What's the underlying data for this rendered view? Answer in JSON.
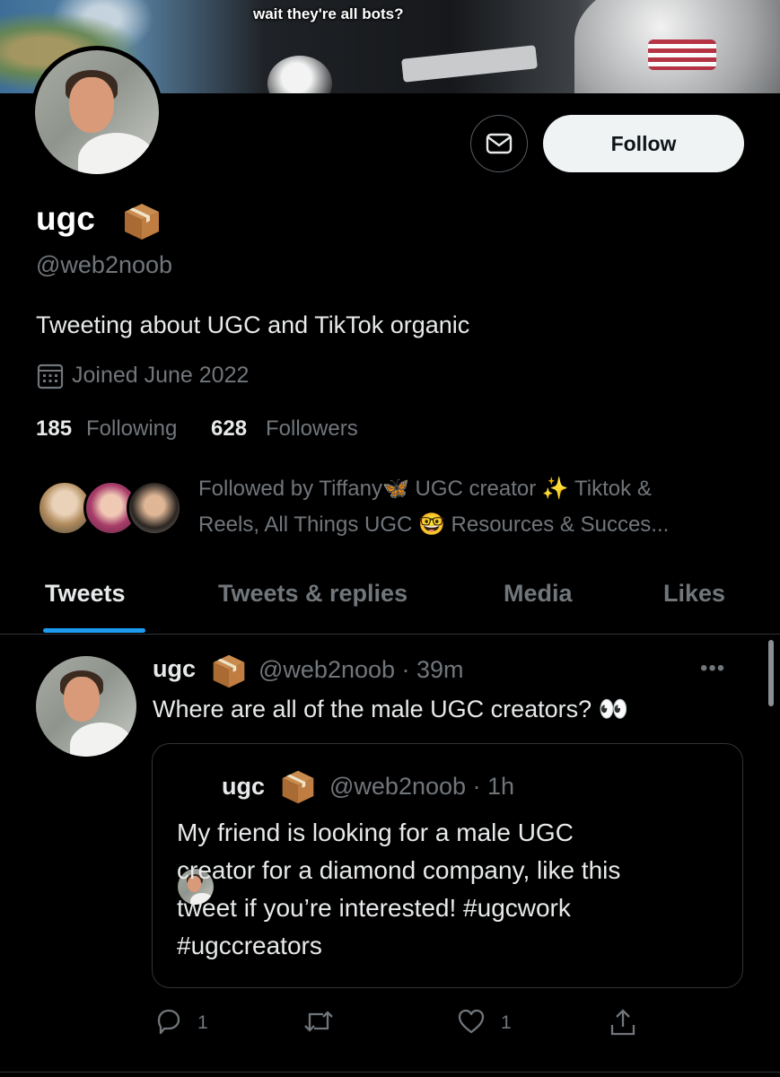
{
  "banner": {
    "caption": "wait they're all bots?"
  },
  "profile": {
    "name": "ugc",
    "name_emoji": "package-icon",
    "handle": "@web2noob",
    "bio": "Tweeting about UGC and TikTok organic",
    "joined": "Joined June 2022",
    "following_count": "185",
    "following_label": "Following",
    "followers_count": "628",
    "followers_label": "Followers",
    "followed_by_line1": "Followed by Tiffany🦋 UGC creator ✨ Tiktok &",
    "followed_by_line2": "Reels, All Things UGC 🤓 Resources & Succes..."
  },
  "actions": {
    "follow_label": "Follow",
    "message_icon": "mail-icon"
  },
  "tabs": [
    {
      "label": "Tweets",
      "active": true
    },
    {
      "label": "Tweets & replies",
      "active": false
    },
    {
      "label": "Media",
      "active": false
    },
    {
      "label": "Likes",
      "active": false
    }
  ],
  "tweet": {
    "name": "ugc",
    "handle_time": "@web2noob · 39m",
    "text": "Where are all of the male UGC creators? 👀",
    "more": "•••",
    "quote": {
      "name": "ugc",
      "handle_time": "@web2noob · 1h",
      "lines": [
        "My friend is looking for a male UGC",
        "creator for a diamond company, like this",
        "tweet if you’re interested! #ugcwork",
        "#ugccreators"
      ]
    },
    "reply_count": "1",
    "like_count": "1"
  },
  "colors": {
    "accent": "#1d9bf0",
    "secondary_text": "#71767b",
    "follow_bg": "#eff3f4"
  }
}
